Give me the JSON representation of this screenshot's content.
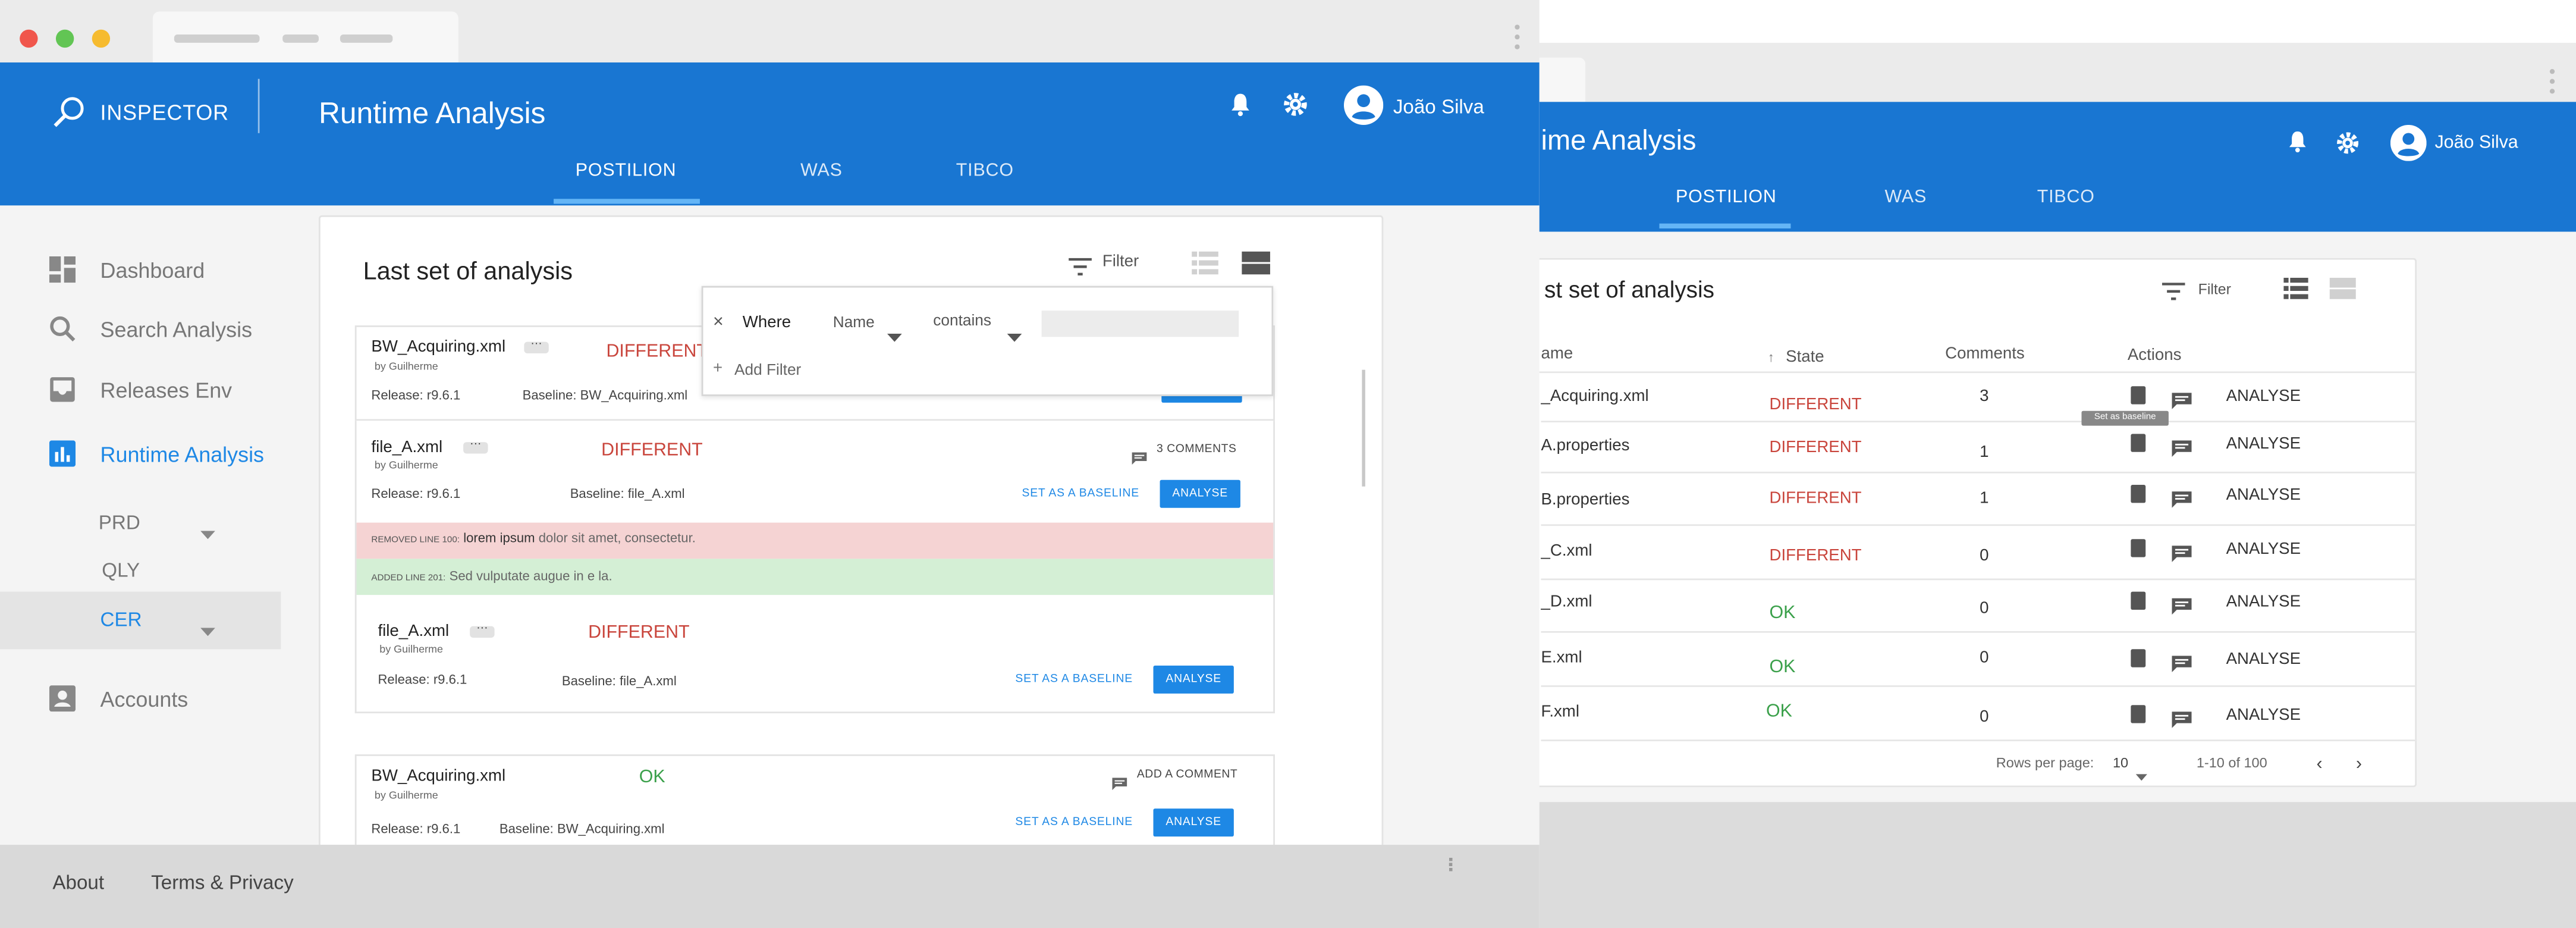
{
  "app": {
    "brand": "INSPECTOR",
    "page_title": "Runtime Analysis",
    "page_title_partial": "ime Analysis",
    "user_name": "João Silva"
  },
  "tabs": [
    {
      "label": "POSTILION"
    },
    {
      "label": "WAS"
    },
    {
      "label": "TIBCO"
    }
  ],
  "sidebar": {
    "items": [
      {
        "label": "Dashboard"
      },
      {
        "label": "Search Analysis"
      },
      {
        "label": "Releases Env"
      },
      {
        "label": "Runtime Analysis"
      },
      {
        "label": "Accounts"
      }
    ],
    "sub_items": [
      {
        "label": "PRD"
      },
      {
        "label": "QLY"
      },
      {
        "label": "CER"
      }
    ]
  },
  "card": {
    "title": "Last set of analysis",
    "title_partial": "st set of analysis",
    "filter_label": "Filter"
  },
  "filter_popup": {
    "where": "Where",
    "field": "Name",
    "operator": "contains",
    "add_filter": "Add Filter"
  },
  "items": [
    {
      "name": "BW_Acquiring.xml",
      "author": "by Guilherme",
      "release": "Release: r9.6.1",
      "baseline": "Baseline: BW_Acquiring.xml",
      "status": "DIFFERENT"
    },
    {
      "name": "file_A.xml",
      "author": "by Guilherme",
      "release": "Release: r9.6.1",
      "baseline": "Baseline: file_A.xml",
      "status": "DIFFERENT",
      "comments": "3 COMMENTS",
      "set_baseline": "SET AS A BASELINE",
      "analyse": "ANALYSE"
    },
    {
      "name": "file_A.xml",
      "author": "by Guilherme",
      "release": "Release: r9.6.1",
      "baseline": "Baseline: file_A.xml",
      "status": "DIFFERENT",
      "set_baseline": "SET AS A BASELINE",
      "analyse": "ANALYSE"
    },
    {
      "name": "BW_Acquiring.xml",
      "author": "by Guilherme",
      "release": "Release: r9.6.1",
      "baseline": "Baseline: BW_Acquiring.xml",
      "status": "OK",
      "comments": "ADD A COMMENT",
      "set_baseline": "SET AS A BASELINE",
      "analyse": "ANALYSE"
    }
  ],
  "diff": {
    "removed_prefix": "REMOVED LINE 100:",
    "removed_emph": "lorem ipsum",
    "removed_rest": " dolor sit amet, consectetur.",
    "added_prefix": "ADDED LINE 201:",
    "added_text": "Sed vulputate augue in e la."
  },
  "table": {
    "headers": {
      "name": "ame",
      "state": "State",
      "comments": "Comments",
      "actions": "Actions"
    },
    "tooltip": "Set as baseline",
    "rows": [
      {
        "name": "_Acquiring.xml",
        "state": "DIFFERENT",
        "comments": "3",
        "action": "ANALYSE"
      },
      {
        "name": "A.properties",
        "state": "DIFFERENT",
        "comments": "1",
        "action": "ANALYSE"
      },
      {
        "name": "B.properties",
        "state": "DIFFERENT",
        "comments": "1",
        "action": "ANALYSE"
      },
      {
        "name": "_C.xml",
        "state": "DIFFERENT",
        "comments": "0",
        "action": "ANALYSE"
      },
      {
        "name": "_D.xml",
        "state": "OK",
        "comments": "0",
        "action": "ANALYSE"
      },
      {
        "name": "E.xml",
        "state": "OK",
        "comments": "0",
        "action": "ANALYSE"
      },
      {
        "name": "F.xml",
        "state": "OK",
        "comments": "0",
        "action": "ANALYSE"
      }
    ],
    "rows_per_page_label": "Rows per page:",
    "rows_per_page": "10",
    "range": "1-10 of 100"
  },
  "footer": {
    "about": "About",
    "terms": "Terms & Privacy"
  },
  "colors": {
    "primary": "#1976d2",
    "different": "#c9453c",
    "ok": "#3aa04a",
    "removed_bg": "#f5d3d3",
    "added_bg": "#d4efd5"
  }
}
